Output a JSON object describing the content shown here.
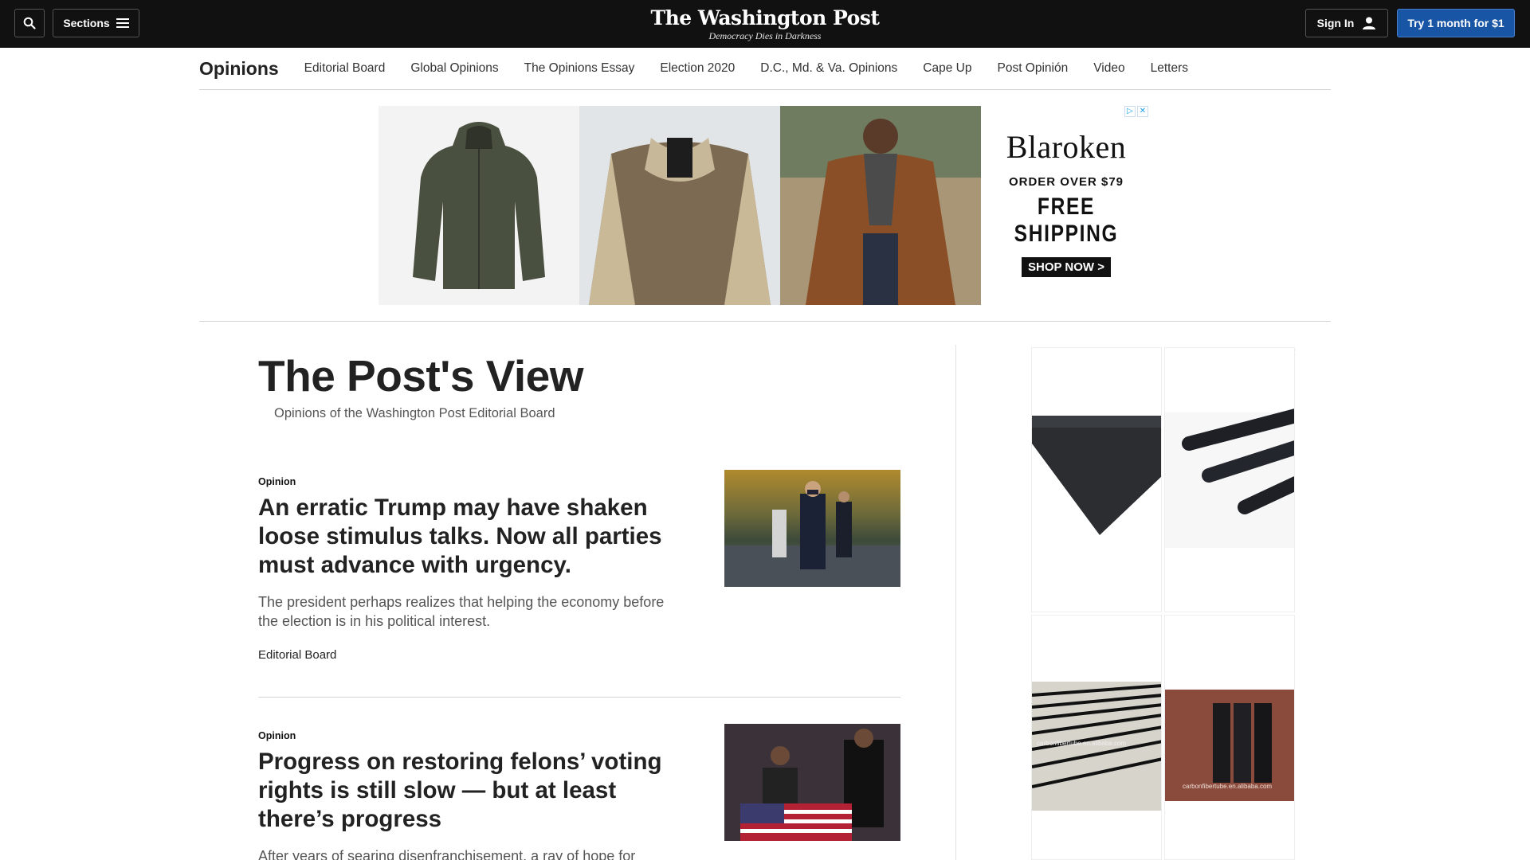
{
  "header": {
    "search_icon": "search-icon",
    "sections_label": "Sections",
    "logo_title": "The Washington Post",
    "logo_tagline": "Democracy Dies in Darkness",
    "signin_label": "Sign In",
    "try_label": "Try 1 month for $1"
  },
  "nav": {
    "title": "Opinions",
    "items": [
      "Editorial Board",
      "Global Opinions",
      "The Opinions Essay",
      "Election 2020",
      "D.C., Md. & Va. Opinions",
      "Cape Up",
      "Post Opinión",
      "Video",
      "Letters"
    ]
  },
  "banner_ad": {
    "brand": "Blaroken",
    "line1": "ORDER OVER $79",
    "line2": "FREE SHIPPING",
    "cta": "SHOP NOW >"
  },
  "page": {
    "title": "The Post's View",
    "subtitle": "Opinions of the Washington Post Editorial Board"
  },
  "articles": [
    {
      "kicker": "Opinion",
      "headline": "An erratic Trump may have shaken loose stimulus talks. Now all parties must advance with urgency.",
      "blurb": "The president perhaps realizes that helping the economy before the election is in his political interest.",
      "byline": "Editorial Board"
    },
    {
      "kicker": "Opinion",
      "headline": "Progress on restoring felons’ voting rights is still slow — but at least there’s progress",
      "blurb": "After years of searing disenfranchisement, a ray of hope for"
    }
  ],
  "side_ad": {
    "watermark_1": "carbonfibertube.en.alibaba.com",
    "watermark_2": "carbonfibertube.en.alibaba.com"
  },
  "colors": {
    "topbar": "#111111",
    "accent": "#1955a5",
    "adchoice": "#1aa3e8"
  }
}
